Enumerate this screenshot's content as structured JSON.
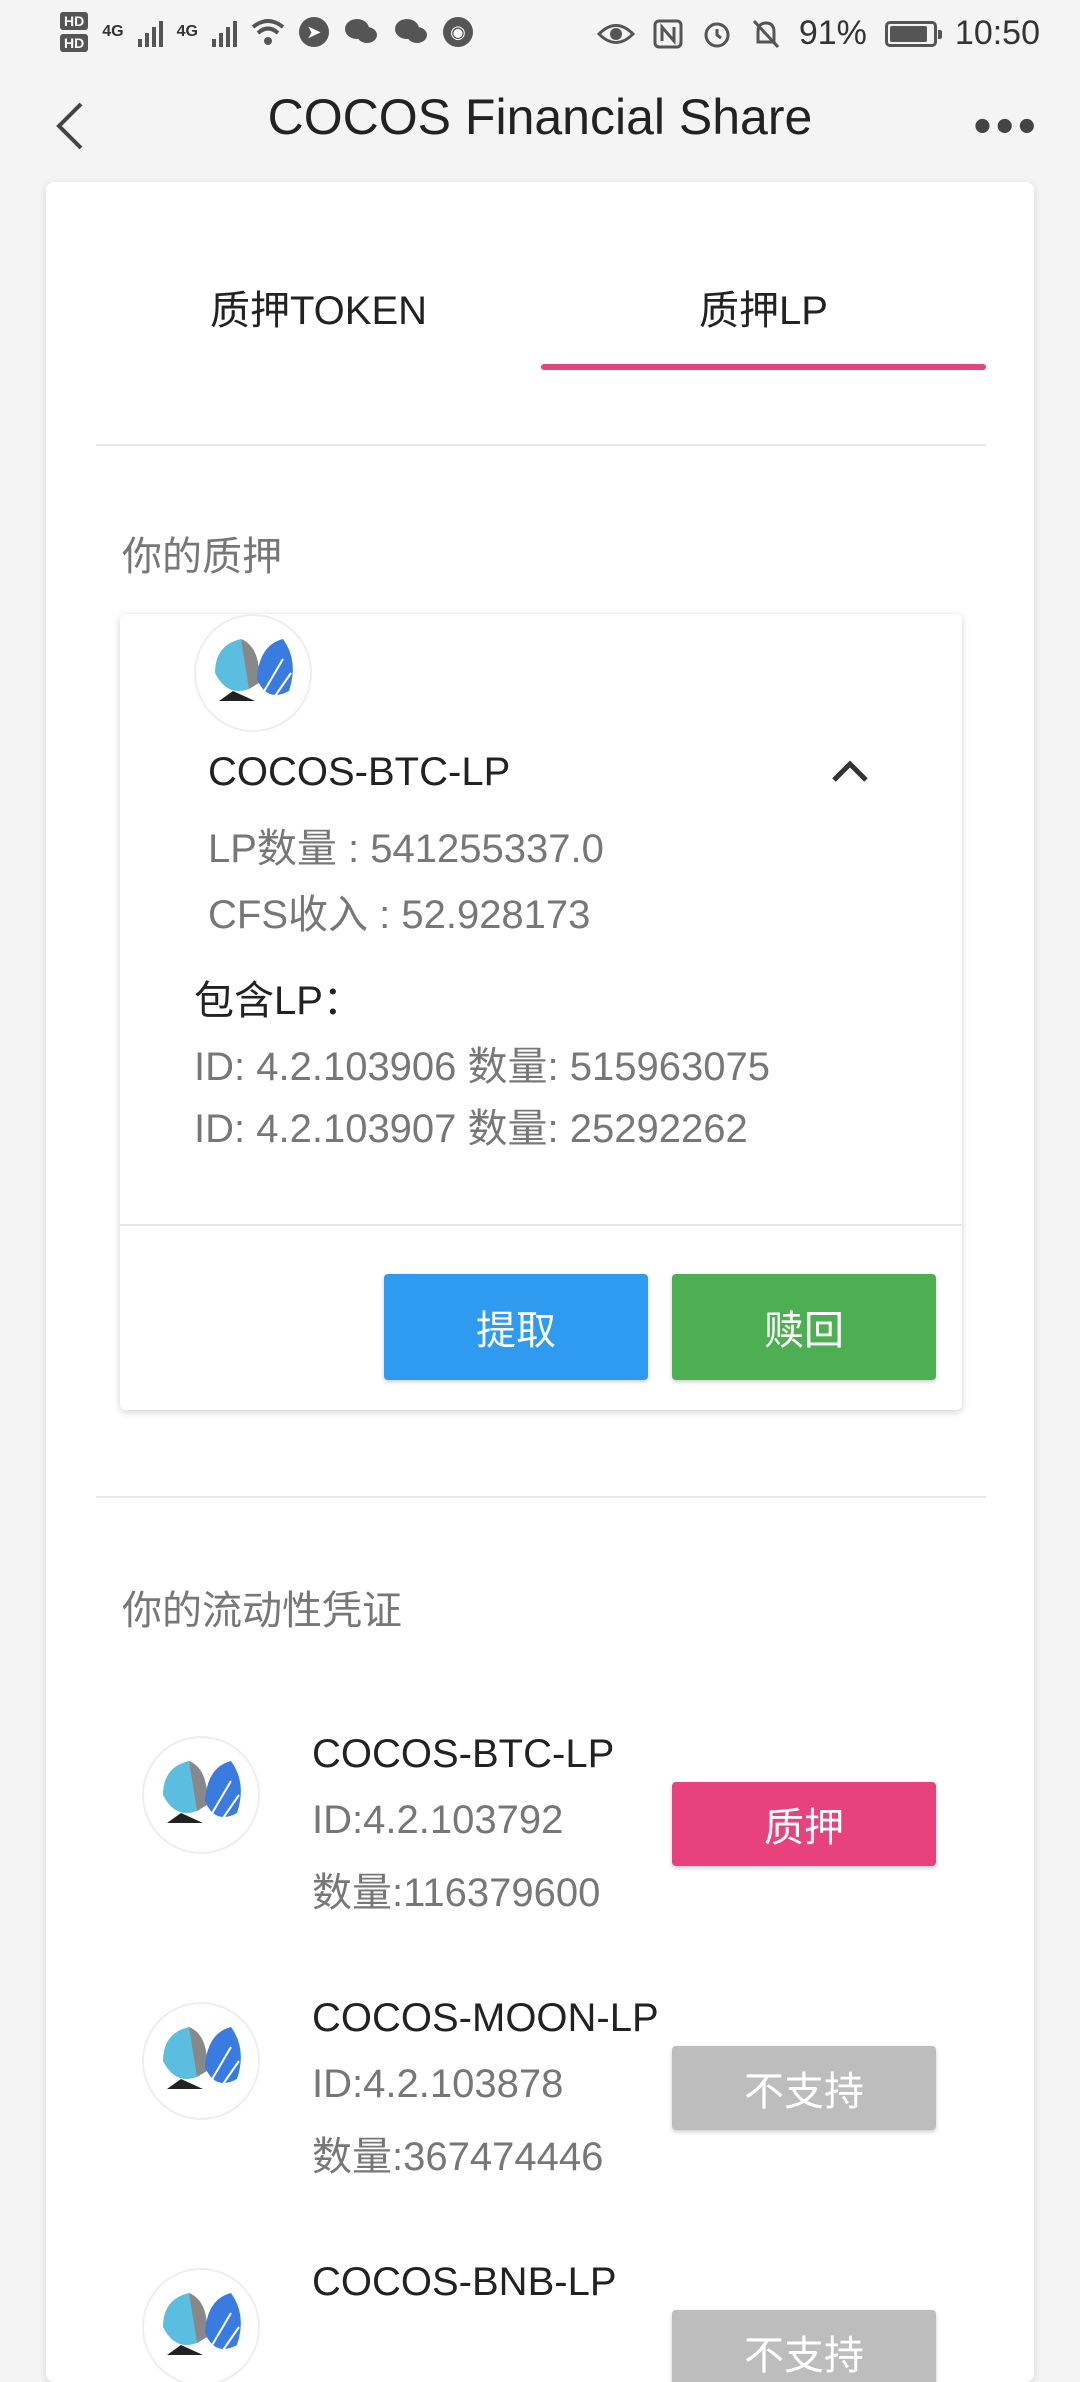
{
  "status_bar": {
    "hd1": "HD",
    "hd2": "HD",
    "net1": "4G",
    "net2": "4G",
    "battery": "91%",
    "time": "10:50"
  },
  "header": {
    "title": "COCOS Financial Share",
    "more": "•••"
  },
  "tabs": [
    {
      "label": "质押TOKEN",
      "active": false
    },
    {
      "label": "质押LP",
      "active": true
    }
  ],
  "your_stake": {
    "section_title": "你的质押",
    "item": {
      "name": "COCOS-BTC-LP",
      "lp_amount": "LP数量 : 541255337.0",
      "cfs_income": "CFS收入 : 52.928173",
      "contains_title": "包含LP：",
      "contains": [
        "ID: 4.2.103906 数量: 515963075",
        "ID: 4.2.103907 数量: 25292262"
      ],
      "withdraw_label": "提取",
      "redeem_label": "赎回"
    }
  },
  "liquidity": {
    "section_title": "你的流动性凭证",
    "items": [
      {
        "name": "COCOS-BTC-LP",
        "id": "ID:4.2.103792",
        "amount": "数量:116379600",
        "action": "质押",
        "supported": true
      },
      {
        "name": "COCOS-MOON-LP",
        "id": "ID:4.2.103878",
        "amount": "数量:367474446",
        "action": "不支持",
        "supported": false
      },
      {
        "name": "COCOS-BNB-LP",
        "id": "",
        "amount": "",
        "action": "不支持",
        "supported": false
      }
    ]
  },
  "colors": {
    "accent_pink": "#e4457f",
    "withdraw_blue": "#2e9bf0",
    "redeem_green": "#4daf52",
    "disabled_grey": "#bdbdbd"
  }
}
